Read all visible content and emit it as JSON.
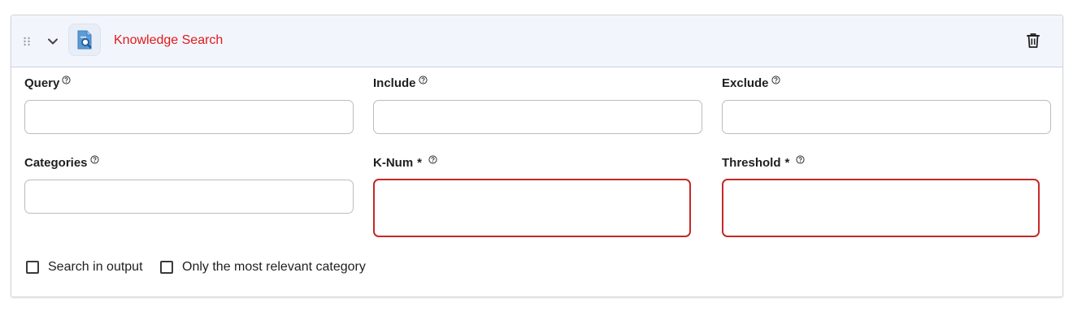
{
  "header": {
    "title": "Knowledge Search",
    "title_color": "#e01a1a",
    "icons": [
      "drag-handle-icon",
      "chevron-down-icon",
      "knowledge-search-icon",
      "trash-icon"
    ]
  },
  "fields": {
    "query": {
      "label": "Query",
      "value": "",
      "required": false
    },
    "include": {
      "label": "Include",
      "value": "",
      "required": false
    },
    "exclude": {
      "label": "Exclude",
      "value": "",
      "required": false
    },
    "categories": {
      "label": "Categories",
      "value": "",
      "required": false
    },
    "k_num": {
      "label": "K-Num",
      "required_mark": "*",
      "value": "",
      "required": true,
      "error": true
    },
    "threshold": {
      "label": "Threshold",
      "required_mark": "*",
      "value": "",
      "required": true,
      "error": true
    }
  },
  "checkboxes": {
    "search_in_output": {
      "label": "Search in output",
      "checked": false
    },
    "most_relevant_category": {
      "label": "Only the most relevant category",
      "checked": false
    }
  },
  "colors": {
    "header_bg": "#f2f5fc",
    "error_border": "#c62828",
    "field_border": "#b9bcc0"
  }
}
